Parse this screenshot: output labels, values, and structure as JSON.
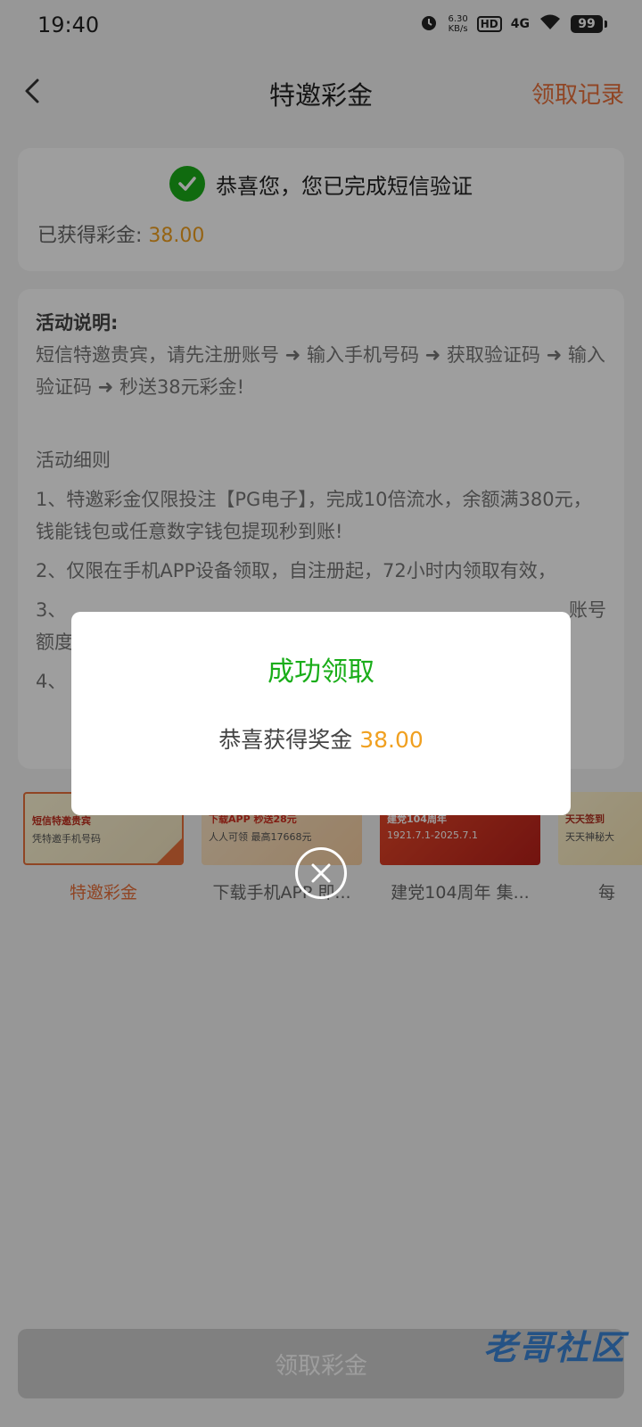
{
  "status": {
    "time": "19:40",
    "speed_value": "6.30",
    "speed_unit": "KB/s",
    "hd": "HD",
    "network": "4G",
    "battery": "99"
  },
  "nav": {
    "title": "特邀彩金",
    "record": "领取记录"
  },
  "success_card": {
    "message": "恭喜您，您已完成短信验证",
    "earned_label": "已获得彩金: ",
    "earned_amount": "38.00"
  },
  "rules": {
    "heading": "活动说明:",
    "description": "短信特邀贵宾，请先注册账号 ➜ 输入手机号码 ➜ 获取验证码 ➜ 输入验证码 ➜ 秒送38元彩金!",
    "details_heading": "活动细则",
    "items": [
      "1、特邀彩金仅限投注【PG电子】，完成10倍流水，余额满380元，钱能钱包或任意数字钱包提现秒到账!",
      "2、仅限在手机APP设备领取，自注册起，72小时内领取有效，",
      "3、",
      "4、"
    ],
    "item3_tail": "账号",
    "item3_line2": "额度"
  },
  "activities": [
    {
      "label": "特邀彩金",
      "thumb_title": "短信特邀贵宾",
      "thumb_sub": "凭特邀手机号码",
      "active": true
    },
    {
      "label": "下载手机APP 即...",
      "thumb_title": "下载APP 秒送28元",
      "thumb_sub": "人人可领 最高17668元",
      "active": false
    },
    {
      "label": "建党104周年 集...",
      "thumb_title": "建党104周年",
      "thumb_sub": "1921.7.1-2025.7.1",
      "active": false
    },
    {
      "label": "每",
      "thumb_title": "天天签到",
      "thumb_sub": "天天神秘大",
      "active": false
    }
  ],
  "bottom": {
    "claim_button": "领取彩金",
    "watermark": "老哥社区"
  },
  "dialog": {
    "title": "成功领取",
    "message_prefix": "恭喜获得奖金 ",
    "amount": "38.00"
  },
  "colors": {
    "accent": "#e8703a",
    "success": "#1aad19",
    "amount": "#f0a020"
  }
}
